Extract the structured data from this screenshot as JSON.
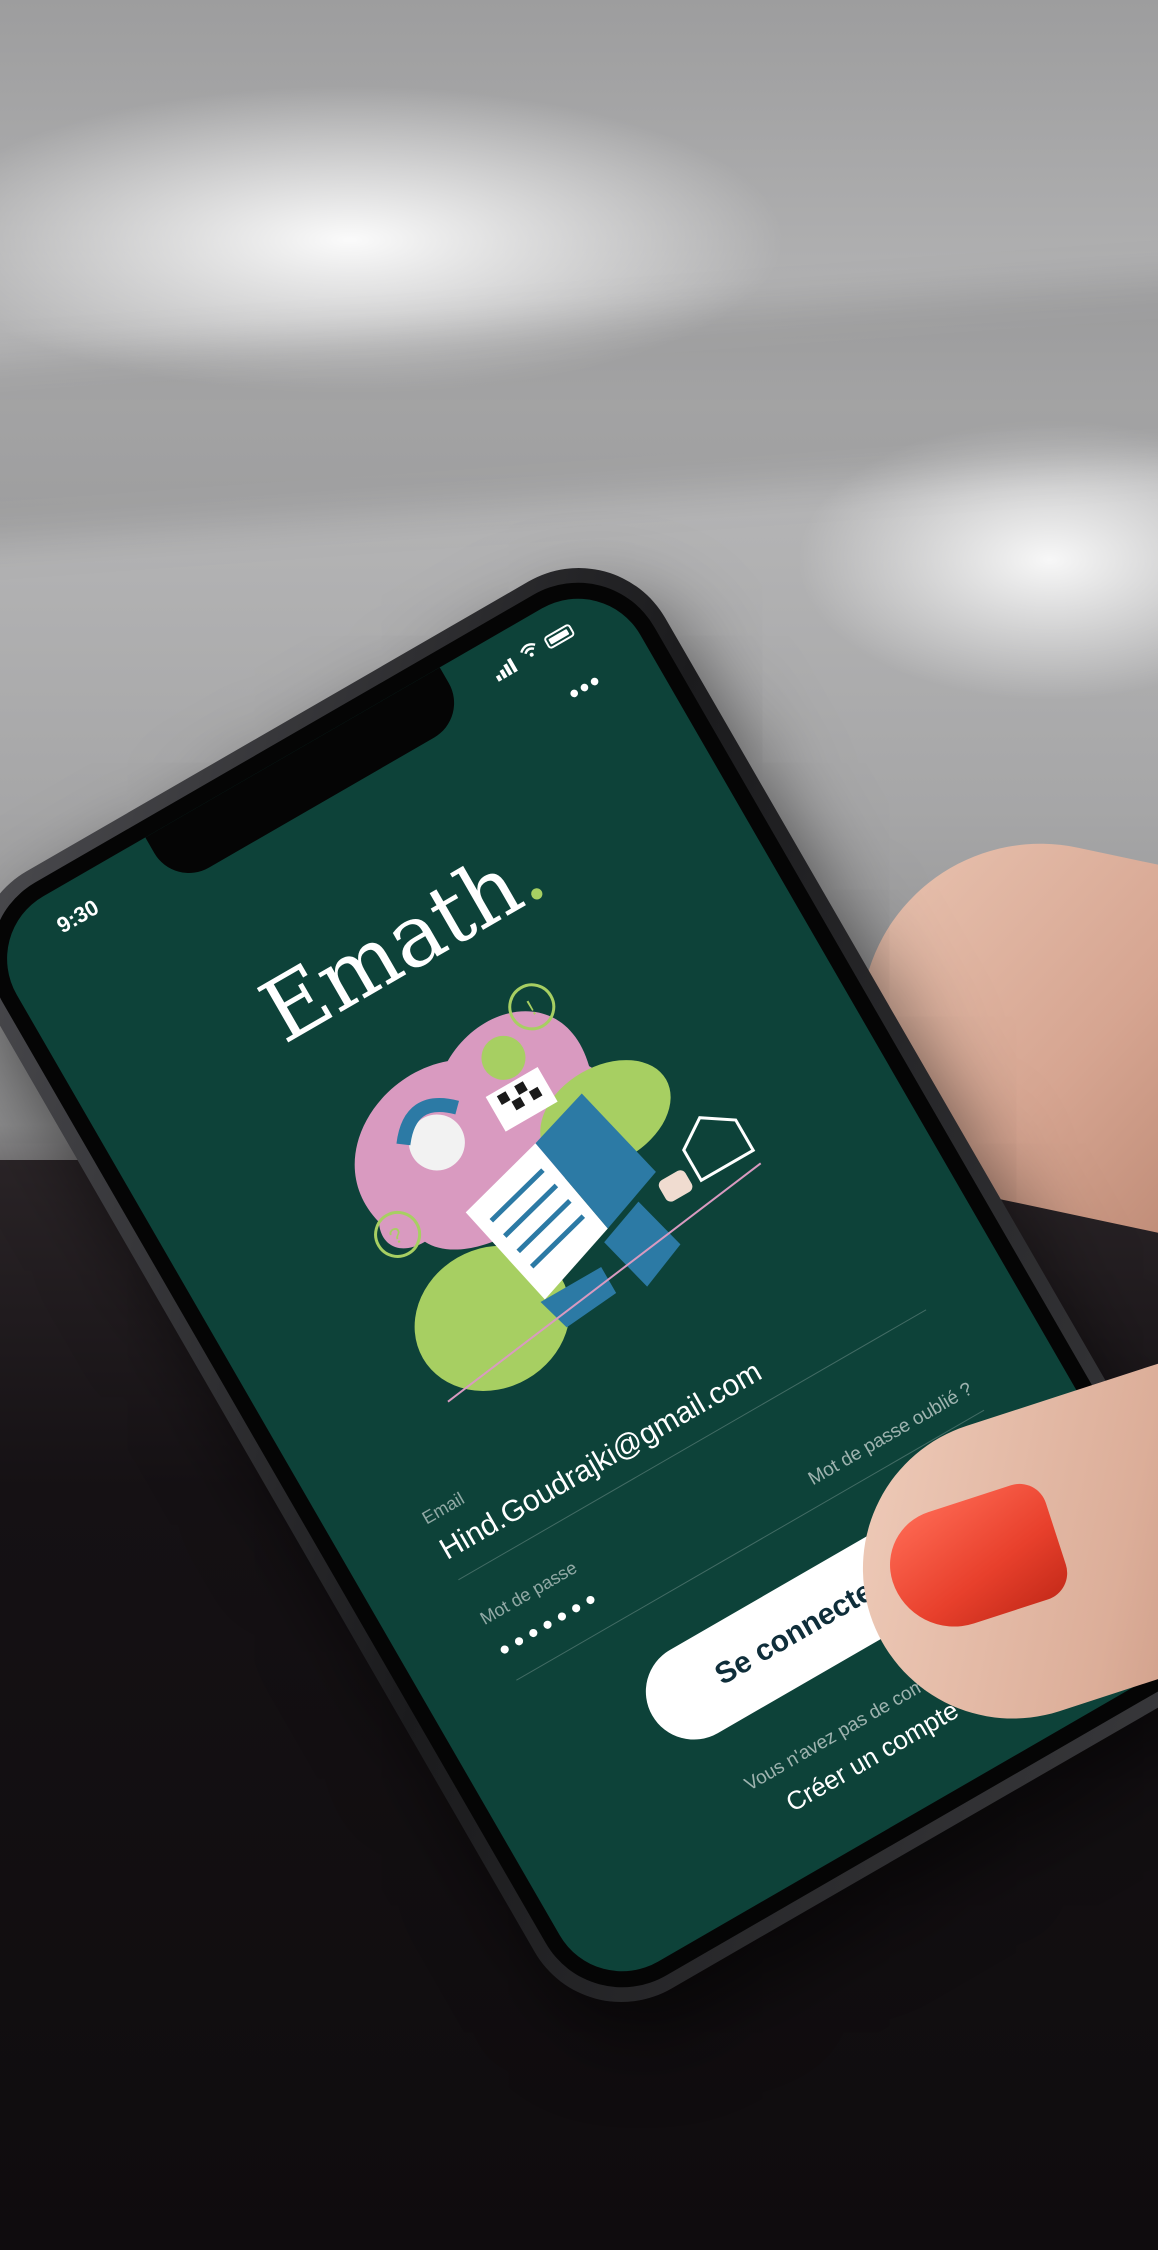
{
  "status_bar": {
    "time": "9:30"
  },
  "app": {
    "logo_text": "Emath",
    "logo_dot": ".",
    "more_label": "•••"
  },
  "form": {
    "email_label": "Email",
    "email_value": "Hind.Goudrajki@gmail.com",
    "password_label": "Mot de passe",
    "password_value": "•••••••",
    "forgot_password": "Mot de passe oublié ?",
    "login_button": "Se connecter",
    "no_account": "Vous n'avez pas de compte ?",
    "create_account": "Créer un compte"
  },
  "colors": {
    "screen_background": "#0d4239",
    "logo_accent": "#a7cf62",
    "button_background": "#ffffff",
    "button_text": "#0f2e3a",
    "nail": "#e8402c"
  },
  "icons": [
    "signal-icon",
    "wifi-icon",
    "battery-icon",
    "more-icon"
  ]
}
